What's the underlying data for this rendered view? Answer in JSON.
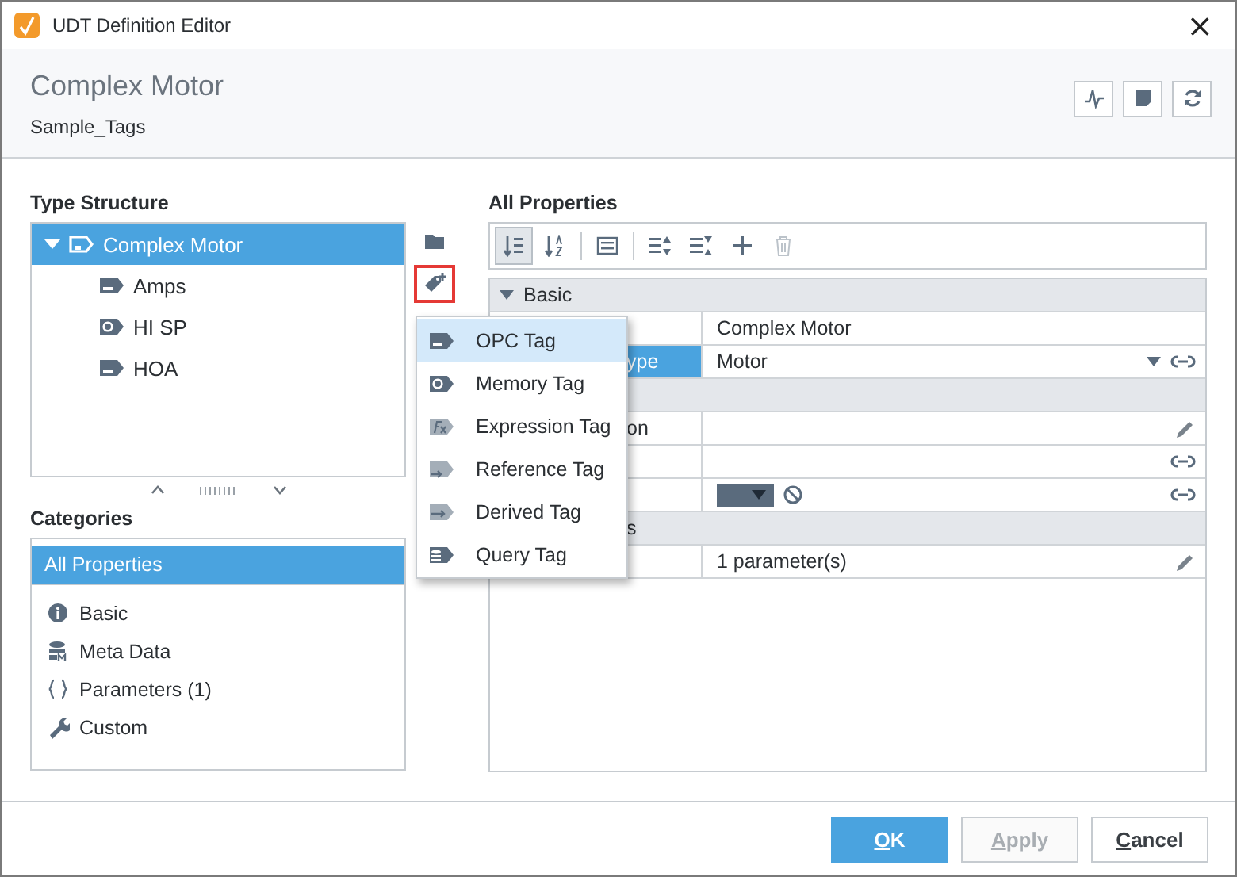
{
  "window": {
    "title": "UDT Definition Editor",
    "close": "×"
  },
  "header": {
    "title": "Complex Motor",
    "subtitle": "Sample_Tags",
    "actions": [
      {
        "kind": "trend"
      },
      {
        "kind": "note"
      },
      {
        "kind": "refresh"
      }
    ]
  },
  "type_structure": {
    "label": "Type Structure",
    "tree": [
      {
        "label": "Complex Motor",
        "kind": "udt",
        "expanded": true,
        "selected": true,
        "children": [
          {
            "label": "Amps",
            "kind": "opc",
            "selected": false
          },
          {
            "label": "HI SP",
            "kind": "memory",
            "selected": false
          },
          {
            "label": "HOA",
            "kind": "opc",
            "selected": false
          }
        ]
      }
    ],
    "actions": [
      {
        "kind": "folder",
        "highlighted": false
      },
      {
        "kind": "add-tag",
        "highlighted": true
      }
    ]
  },
  "categories": {
    "label": "Categories",
    "items": [
      {
        "label": "All Properties",
        "kind": "all",
        "selected": true
      },
      {
        "label": "Basic",
        "kind": "info",
        "selected": false
      },
      {
        "label": "Meta Data",
        "kind": "meta",
        "selected": false
      },
      {
        "label": "Parameters (1)",
        "kind": "braces",
        "selected": false
      },
      {
        "label": "Custom",
        "kind": "wrench",
        "selected": false
      }
    ]
  },
  "properties": {
    "label": "All Properties",
    "toolbar": [
      {
        "kind": "sort-category",
        "selected": true,
        "disabled": false
      },
      {
        "kind": "sort-alpha",
        "selected": false,
        "disabled": false
      },
      {
        "kind": "list",
        "selected": false,
        "disabled": false
      },
      {
        "kind": "expand",
        "selected": false,
        "disabled": false
      },
      {
        "kind": "collapse",
        "selected": false,
        "disabled": false
      },
      {
        "kind": "add",
        "selected": false,
        "disabled": false
      },
      {
        "kind": "delete",
        "selected": false,
        "disabled": true
      }
    ],
    "rows": [
      {
        "kind": "group",
        "label": "Basic",
        "expanded": true
      },
      {
        "kind": "property",
        "value": "Complex Motor",
        "selected": false
      },
      {
        "kind": "property",
        "name": "ype",
        "value": "Motor",
        "selected": true,
        "dropdown": true,
        "bindable": true
      },
      {
        "kind": "group"
      },
      {
        "kind": "property",
        "name": "on",
        "selected": false,
        "editable": true
      },
      {
        "kind": "property",
        "selected": false,
        "bindable": true
      },
      {
        "kind": "property",
        "selected": false,
        "color_picker": true,
        "bindable": true
      },
      {
        "kind": "group",
        "label": "s"
      },
      {
        "kind": "property",
        "value": "1 parameter(s)",
        "selected": false,
        "editable": true
      }
    ]
  },
  "menu": {
    "items": [
      {
        "label": "OPC Tag",
        "kind": "opc",
        "selected": true
      },
      {
        "label": "Memory Tag",
        "kind": "memory",
        "selected": false
      },
      {
        "label": "Expression Tag",
        "kind": "expression",
        "selected": false
      },
      {
        "label": "Reference Tag",
        "kind": "reference",
        "selected": false
      },
      {
        "label": "Derived Tag",
        "kind": "derived",
        "selected": false
      },
      {
        "label": "Query Tag",
        "kind": "query",
        "selected": false
      }
    ]
  },
  "buttons": [
    {
      "label": "OK",
      "kind": "primary",
      "disabled": false,
      "mnemonic_underlined": true
    },
    {
      "label": "Apply",
      "kind": "normal",
      "disabled": true,
      "mnemonic_underlined": true
    },
    {
      "label": "Cancel",
      "kind": "normal",
      "disabled": false,
      "mnemonic_underlined": true
    }
  ]
}
